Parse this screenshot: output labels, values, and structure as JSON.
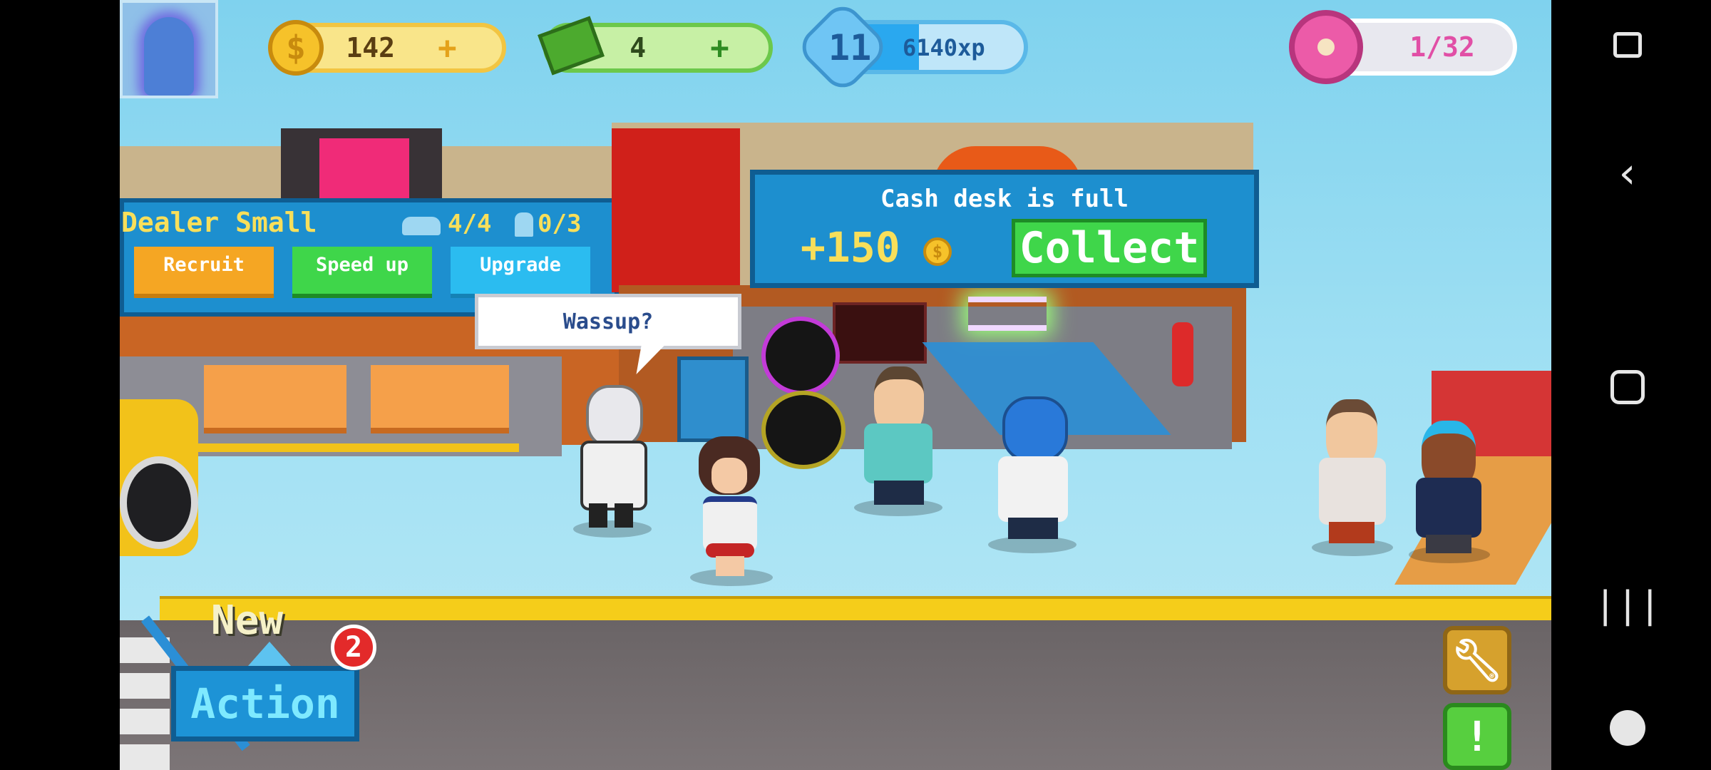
{
  "hud": {
    "coins": "142",
    "cash": "4",
    "level": "11",
    "xp": "6140xp",
    "xp_progress": 0.38,
    "donuts": "1/32",
    "coin_symbol": "$",
    "plus": "+"
  },
  "dealer": {
    "title": "Dealer Small",
    "cars": "4/4",
    "staff": "0/3",
    "buttons": {
      "recruit": "Recruit",
      "speed_up": "Speed up",
      "upgrade": "Upgrade"
    }
  },
  "cash_desk": {
    "title": "Cash desk is full",
    "amount": "+150",
    "coin_symbol": "$",
    "collect": "Collect"
  },
  "speech": "Wassup?",
  "bottom": {
    "new_label": "New",
    "badge_count": "2",
    "action_label": "Action",
    "alert_label": "!"
  },
  "colors": {
    "sky": "#9edff3",
    "panel_blue": "#1d8fcf",
    "recruit": "#f5a623",
    "speed_up": "#3fd64a",
    "upgrade": "#2bbcf0",
    "collect": "#3fd64a",
    "badge": "#e32a2a",
    "road_line": "#f5cd1a"
  },
  "icons": [
    "silhouette-avatar-icon",
    "coin-icon",
    "cash-icon",
    "star-level-icon",
    "donut-icon",
    "car-icon",
    "worker-icon",
    "wrench-icon",
    "alert-icon",
    "touch-icon",
    "back-icon",
    "home-icon",
    "recents-icon",
    "gamepad-icon"
  ]
}
